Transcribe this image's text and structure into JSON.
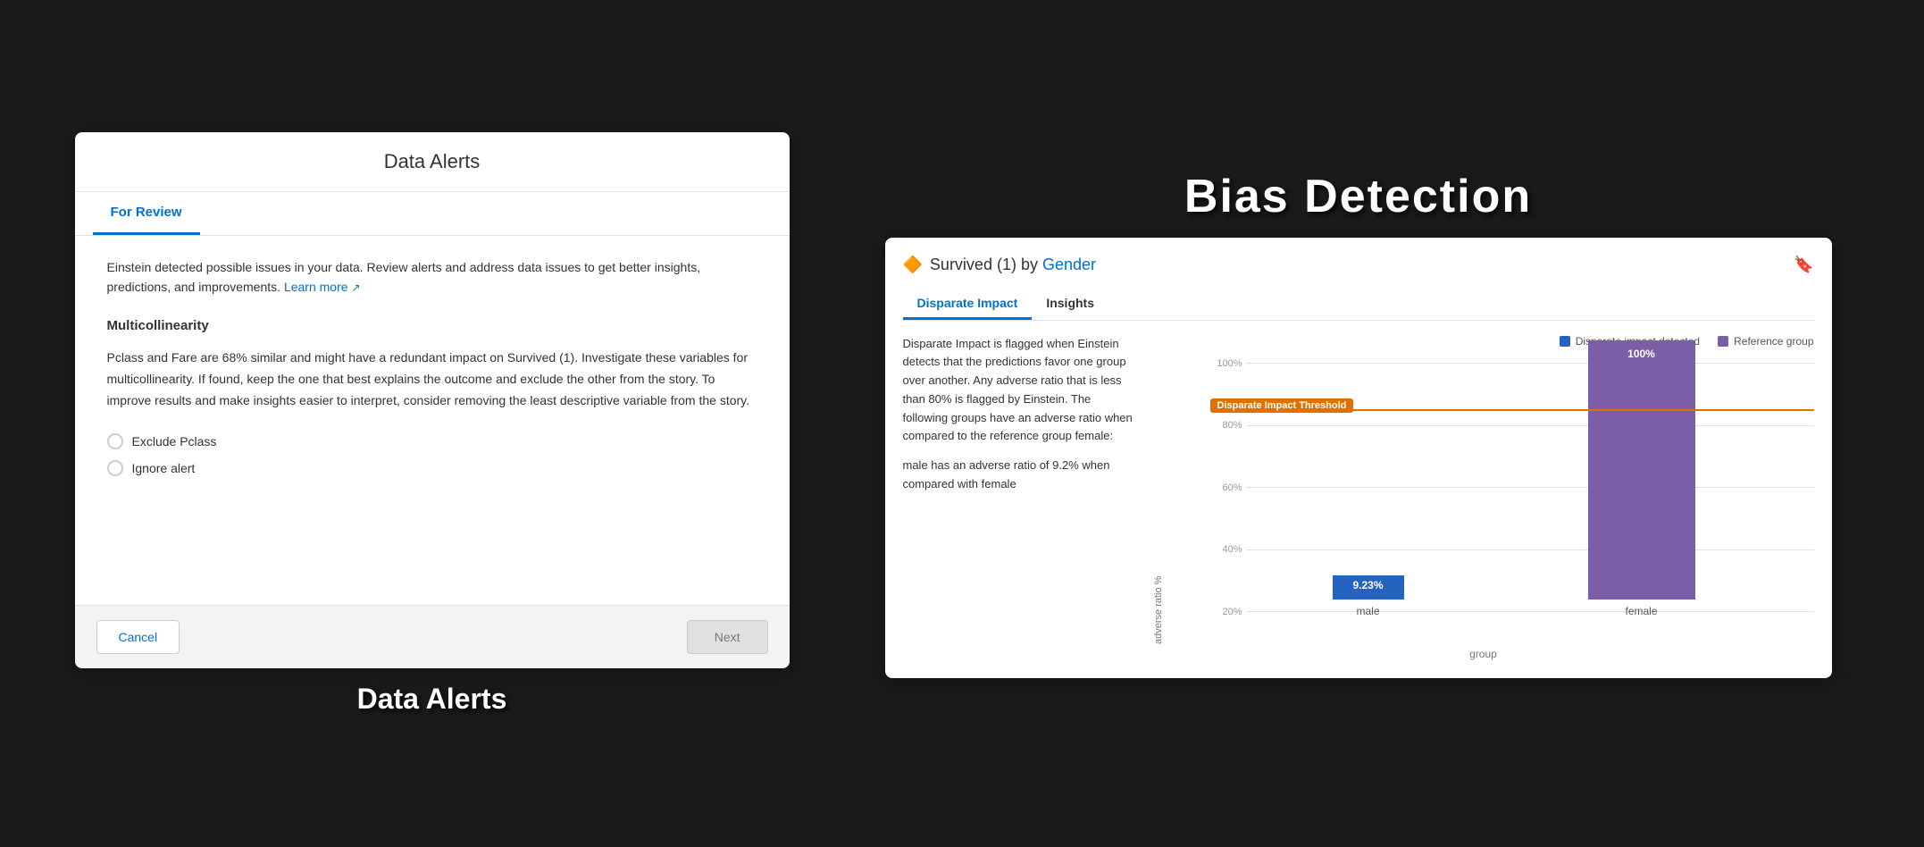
{
  "left_panel": {
    "title": "Data Alerts",
    "tab_label": "For Review",
    "intro_text": "Einstein detected possible issues in your data. Review alerts and address data issues to get better insights, predictions, and improvements.",
    "learn_more_label": "Learn more",
    "section_title": "Multicollinearity",
    "section_body": "Pclass and Fare are 68% similar and might have a redundant impact on Survived (1). Investigate these variables for multicollinearity. If found, keep the one that best explains the outcome and exclude the other from the story. To improve results and make insights easier to interpret, consider removing the least descriptive variable from the story.",
    "radio_options": [
      "Exclude Pclass",
      "Ignore alert"
    ],
    "cancel_label": "Cancel",
    "next_label": "Next",
    "bottom_label": "Data Alerts"
  },
  "right_panel": {
    "title": "Bias Detection",
    "card": {
      "title_prefix": "Survived (1) by",
      "title_highlight": "Gender",
      "tabs": [
        "Disparate Impact",
        "Insights"
      ],
      "active_tab": "Disparate Impact",
      "description_paragraphs": [
        "Disparate Impact is flagged when Einstein detects that the predictions favor one group over another. Any adverse ratio that is less than 80% is flagged by Einstein. The following groups have an adverse ratio when compared to the reference group female:",
        "male has an adverse ratio of 9.2% when compared with female"
      ],
      "legend": [
        {
          "label": "Disparate impact detected",
          "color": "#2563c0"
        },
        {
          "label": "Reference group",
          "color": "#7b5ea7"
        }
      ],
      "threshold": {
        "label": "Disparate Impact Threshold",
        "value_pct": 80
      },
      "y_axis_labels": [
        "100%",
        "80%",
        "60%",
        "40%",
        "20%"
      ],
      "y_axis_title": "adverse ratio %",
      "bars": [
        {
          "group": "male",
          "value": 9.23,
          "color": "#2563c0",
          "height_pct": 9.23,
          "label": "9.23%"
        },
        {
          "group": "female",
          "value": 100,
          "color": "#7b5ea7",
          "height_pct": 100,
          "label": "100%"
        }
      ],
      "x_axis_label": "group"
    }
  }
}
